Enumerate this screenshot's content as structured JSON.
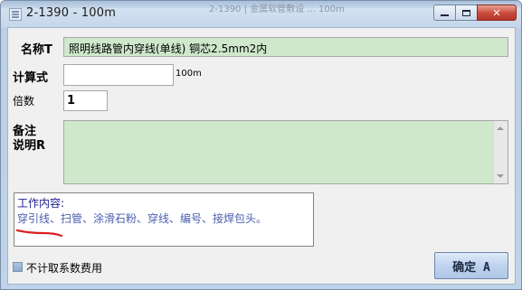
{
  "window": {
    "title": "2-1390 - 100m",
    "background_text": "2-1390 | 金属软管敷设 ... 100m"
  },
  "form": {
    "name_label": "名称T",
    "name_value": "照明线路管内穿线(单线) 铜芯2.5mm2内",
    "calc_label": "计算式",
    "calc_value": "",
    "calc_unit": "100m",
    "multiplier_label": "倍数",
    "multiplier_value": "1",
    "remark_label_line1": "备注",
    "remark_label_line2": "说明R",
    "remark_value": "",
    "work_heading": "工作内容:",
    "work_content": "穿引线、扫管、涂滑石粉、穿线、编号、接焊包头。",
    "exclude_fee_label": "不计取系数费用",
    "exclude_fee_checked": true,
    "ok_button": "确定 A"
  },
  "colors": {
    "field_green": "#cfe8cc",
    "annotation_red": "#d91f1f",
    "work_text_blue": "#4a5fae"
  },
  "icons": {
    "app": "app-window-icon",
    "minimize": "minimize-icon",
    "maximize": "maximize-icon",
    "close": "close-icon"
  }
}
